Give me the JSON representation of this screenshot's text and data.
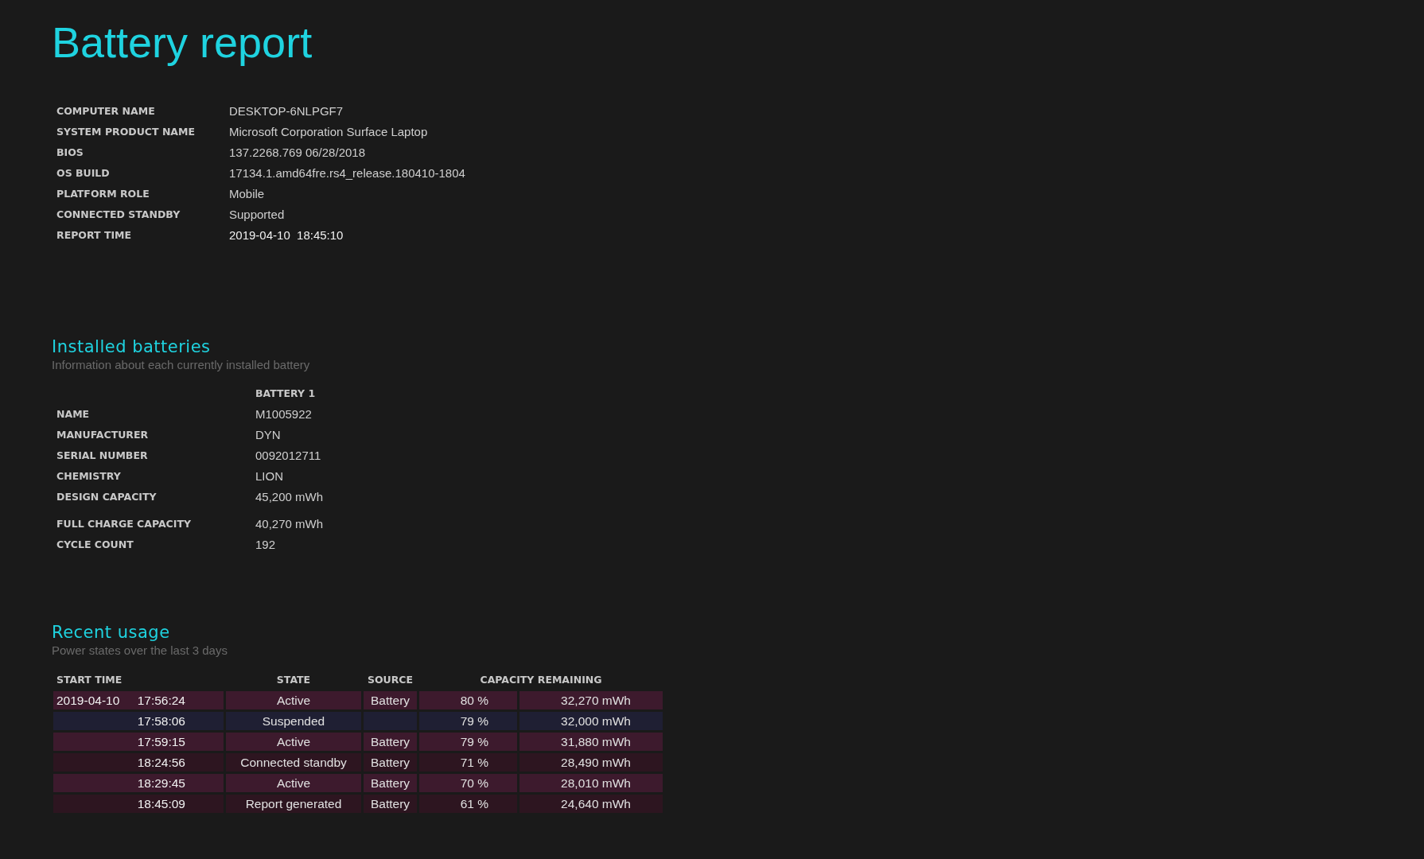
{
  "title": "Battery report",
  "system_info": [
    {
      "label": "COMPUTER NAME",
      "value": "DESKTOP-6NLPGF7"
    },
    {
      "label": "SYSTEM PRODUCT NAME",
      "value": "Microsoft Corporation Surface Laptop"
    },
    {
      "label": "BIOS",
      "value": "137.2268.769 06/28/2018"
    },
    {
      "label": "OS BUILD",
      "value": "17134.1.amd64fre.rs4_release.180410-1804"
    },
    {
      "label": "PLATFORM ROLE",
      "value": "Mobile"
    },
    {
      "label": "CONNECTED STANDBY",
      "value": "Supported"
    },
    {
      "label": "REPORT TIME",
      "value": "2019-04-10  18:45:10"
    }
  ],
  "installed_batteries": {
    "heading": "Installed batteries",
    "subtitle": "Information about each currently installed battery",
    "column": "BATTERY 1",
    "rows": [
      {
        "label": "NAME",
        "value": "M1005922"
      },
      {
        "label": "MANUFACTURER",
        "value": "DYN"
      },
      {
        "label": "SERIAL NUMBER",
        "value": "0092012711"
      },
      {
        "label": "CHEMISTRY",
        "value": "LION"
      },
      {
        "label": "DESIGN CAPACITY",
        "value": "45,200 mWh"
      },
      {
        "label": "FULL CHARGE CAPACITY",
        "value": "40,270 mWh"
      },
      {
        "label": "CYCLE COUNT",
        "value": "192"
      }
    ]
  },
  "recent_usage": {
    "heading": "Recent usage",
    "subtitle": "Power states over the last 3 days",
    "columns": [
      "START TIME",
      "STATE",
      "SOURCE",
      "CAPACITY REMAINING"
    ],
    "rows": [
      {
        "kind": "active",
        "date": "2019-04-10",
        "time": "17:56:24",
        "state": "Active",
        "source": "Battery",
        "percent": "80 %",
        "capacity": "32,270 mWh"
      },
      {
        "kind": "suspended",
        "time": "17:58:06",
        "state": "Suspended",
        "percent": "79 %",
        "capacity": "32,000 mWh"
      },
      {
        "kind": "active",
        "time": "17:59:15",
        "state": "Active",
        "source": "Battery",
        "percent": "79 %",
        "capacity": "31,880 mWh"
      },
      {
        "kind": "standby",
        "time": "18:24:56",
        "state": "Connected standby",
        "source": "Battery",
        "percent": "71 %",
        "capacity": "28,490 mWh"
      },
      {
        "kind": "active",
        "time": "18:29:45",
        "state": "Active",
        "source": "Battery",
        "percent": "70 %",
        "capacity": "28,010 mWh"
      },
      {
        "kind": "standby",
        "time": "18:45:09",
        "state": "Report generated",
        "source": "Battery",
        "percent": "61 %",
        "capacity": "24,640 mWh"
      }
    ]
  }
}
